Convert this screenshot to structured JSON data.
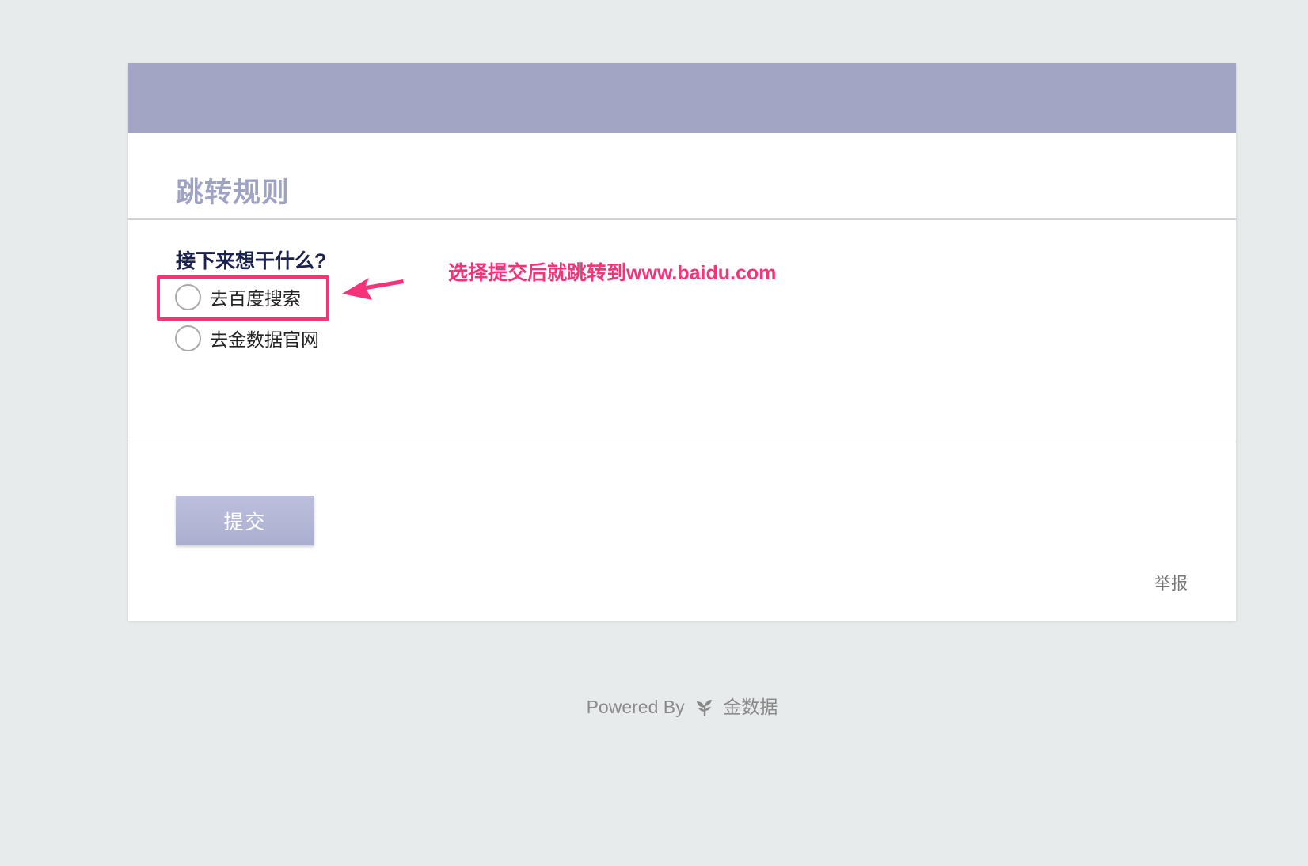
{
  "form": {
    "title": "跳转规则",
    "question": "接下来想干什么?",
    "options": [
      {
        "label": "去百度搜索",
        "selected": false
      },
      {
        "label": "去金数据官网",
        "selected": false
      }
    ],
    "submit_label": "提交",
    "report_label": "举报"
  },
  "annotation": {
    "text": "选择提交后就跳转到www.baidu.com",
    "highlight_color": "#f13576",
    "arrow_icon": "arrow-left-icon"
  },
  "footer": {
    "powered_by": "Powered By",
    "brand_icon": "sprout-icon",
    "brand": "金数据"
  },
  "colors": {
    "page_background": "#e8ebec",
    "header_band": "#a2a5c3",
    "title": "#9fa3c3",
    "question": "#1b2150",
    "submit_button": "#b3b6d5",
    "annotation": "#f5327a"
  }
}
